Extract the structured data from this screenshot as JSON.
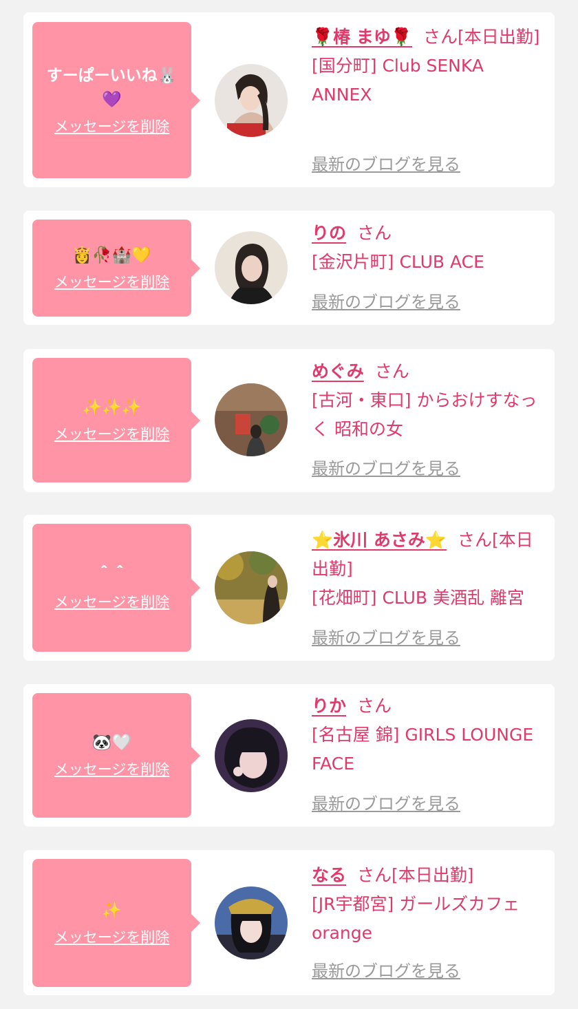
{
  "messages": [
    {
      "text": "すーぱーいいね🐰💜",
      "delete_label": "メッセージを削除",
      "name": "🌹椿 まゆ🌹",
      "suffix": "さん[本日出勤]",
      "shop": "[国分町] Club SENKA ANNEX",
      "blog_label": "最新のブログを見る"
    },
    {
      "text": "👸🥀🏰💛",
      "delete_label": "メッセージを削除",
      "name": "りの",
      "suffix": "さん",
      "shop": "[金沢片町] CLUB ACE",
      "blog_label": "最新のブログを見る"
    },
    {
      "text": "✨✨✨",
      "delete_label": "メッセージを削除",
      "name": "めぐみ",
      "suffix": "さん",
      "shop": "[古河・東口] からおけすなっく 昭和の女",
      "blog_label": "最新のブログを見る"
    },
    {
      "text": "＾＾",
      "delete_label": "メッセージを削除",
      "name": "⭐氷川 あさみ⭐",
      "suffix": "さん[本日出勤]",
      "shop": "[花畑町] CLUB 美酒乱 離宮",
      "blog_label": "最新のブログを見る"
    },
    {
      "text": "🐼🤍",
      "delete_label": "メッセージを削除",
      "name": "りか",
      "suffix": "さん",
      "shop": "[名古屋 錦] GIRLS LOUNGE FACE",
      "blog_label": "最新のブログを見る"
    },
    {
      "text": "✨",
      "delete_label": "メッセージを削除",
      "name": "なる",
      "suffix": "さん[本日出勤]",
      "shop": "[JR宇都宮] ガールズカフェorange",
      "blog_label": "最新のブログを見る"
    }
  ]
}
